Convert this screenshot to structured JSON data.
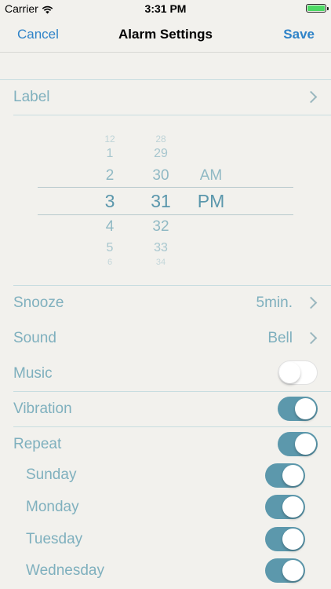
{
  "status_bar": {
    "carrier": "Carrier",
    "time": "3:31 PM",
    "wifi_icon": "wifi-icon",
    "battery_icon": "battery-icon",
    "battery_level": 1.0,
    "battery_color": "#4cd964"
  },
  "nav": {
    "cancel_label": "Cancel",
    "title": "Alarm Settings",
    "save_label": "Save",
    "accent_color": "#2f83c8"
  },
  "label_row": {
    "label": "Label",
    "chevron_icon": "chevron-right-icon"
  },
  "time_picker": {
    "hours": [
      "12",
      "1",
      "2",
      "3",
      "4",
      "5",
      "6"
    ],
    "minutes": [
      "28",
      "29",
      "30",
      "31",
      "32",
      "33",
      "34"
    ],
    "periods": [
      "AM",
      "PM"
    ],
    "selected_hour": "3",
    "selected_minute": "31",
    "selected_period": "PM"
  },
  "snooze_row": {
    "label": "Snooze",
    "value": "5min.",
    "chevron_icon": "chevron-right-icon"
  },
  "sound_row": {
    "label": "Sound",
    "value": "Bell",
    "chevron_icon": "chevron-right-icon"
  },
  "music_row": {
    "label": "Music",
    "enabled": false
  },
  "vibration_row": {
    "label": "Vibration",
    "enabled": true
  },
  "repeat_row": {
    "label": "Repeat",
    "enabled": true
  },
  "repeat_days": [
    {
      "label": "Sunday",
      "enabled": true
    },
    {
      "label": "Monday",
      "enabled": true
    },
    {
      "label": "Tuesday",
      "enabled": true
    },
    {
      "label": "Wednesday",
      "enabled": true
    }
  ],
  "colors": {
    "background": "#f2f1ed",
    "label_text": "#7fb0be",
    "toggle_on": "#5c98ac",
    "divider": "#c8dde0"
  }
}
